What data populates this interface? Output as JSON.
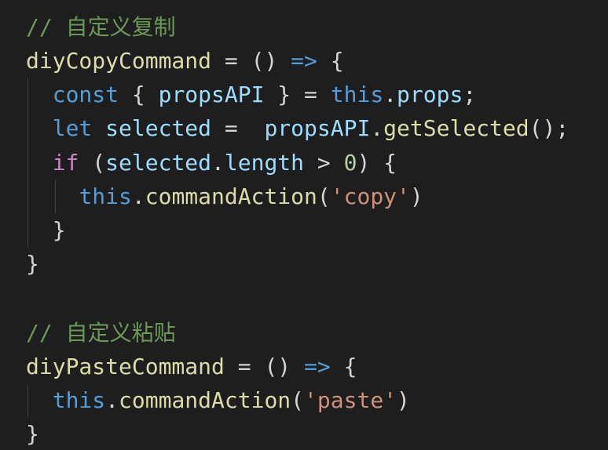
{
  "code": {
    "comment_copy": "// 自定义复制",
    "copy_fn": "diyCopyCommand",
    "copy_assign": " = () ",
    "arrow": "=>",
    "open_brace": " {",
    "const_kw": "const",
    "destr_open": " { ",
    "props_api": "propsAPI",
    "destr_close": " } = ",
    "this_kw": "this",
    "dot": ".",
    "props": "props",
    "semi": ";",
    "let_kw": "let",
    "selected": "selected",
    "let_assign": " =  ",
    "get_selected": "getSelected",
    "call_semi": "();",
    "if_kw": "if",
    "if_open": " (",
    "length": "length",
    "gt": " > ",
    "zero": "0",
    "if_close": ") {",
    "command_action": "commandAction",
    "paren_open": "(",
    "copy_str": "'copy'",
    "paren_close": ")",
    "close_brace": "}",
    "comment_paste": "// 自定义粘贴",
    "paste_fn": "diyPasteCommand",
    "paste_str": "'paste'"
  }
}
